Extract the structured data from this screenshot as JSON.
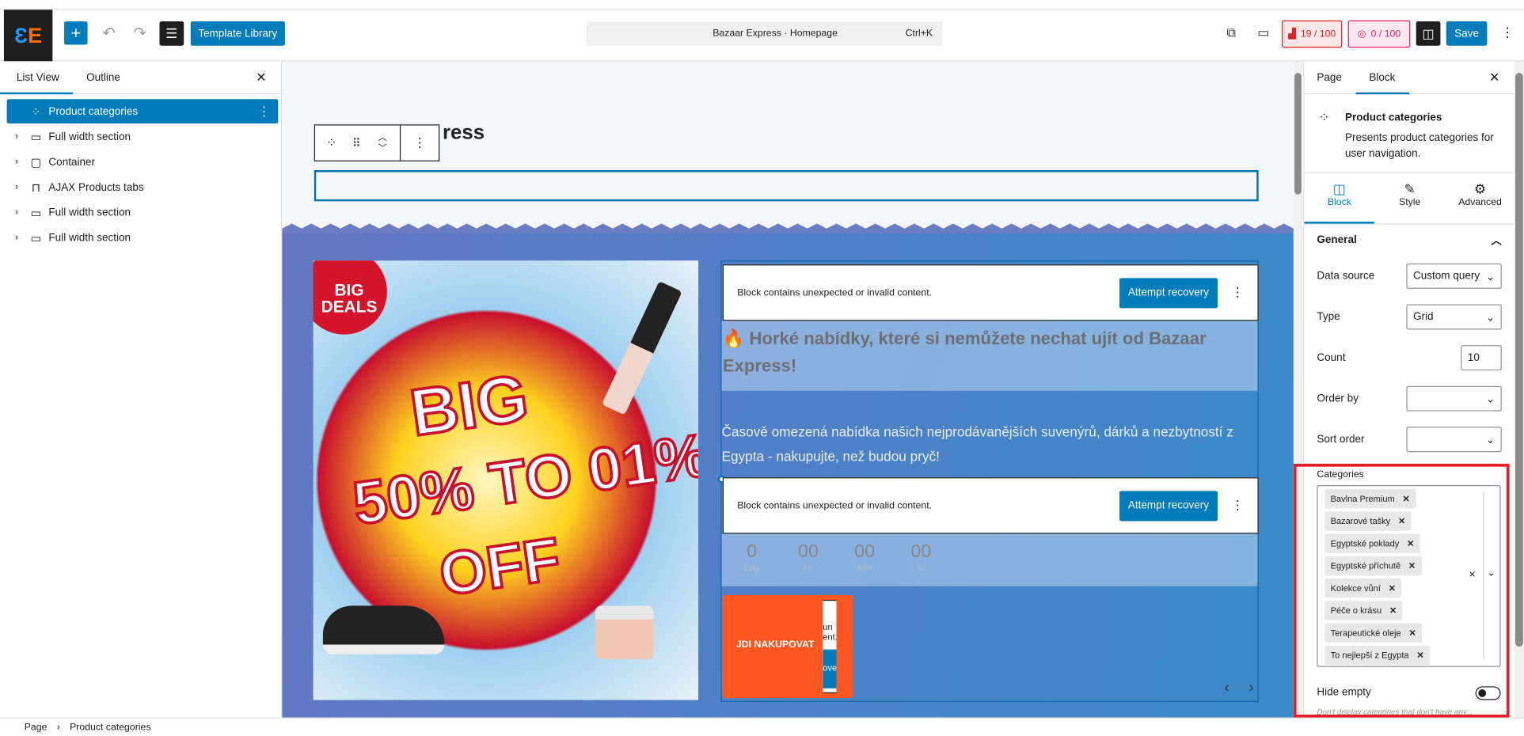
{
  "header": {
    "add_label": "+",
    "template_library": "Template Library",
    "command_bar": {
      "title": "Bazaar Express · Homepage",
      "shortcut": "Ctrl+K"
    },
    "seo_score": "19 / 100",
    "readability_score": "0 / 100",
    "save": "Save"
  },
  "left_panel": {
    "tabs": [
      "List View",
      "Outline"
    ],
    "items": [
      {
        "label": "Product categories",
        "selected": true
      },
      {
        "label": "Full width section"
      },
      {
        "label": "Container"
      },
      {
        "label": "AJAX Products tabs"
      },
      {
        "label": "Full width section"
      },
      {
        "label": "Full width section"
      }
    ]
  },
  "canvas": {
    "heading_partial": "ress",
    "promo_image": {
      "badge": "BIG DEALS",
      "line1": "BIG",
      "line2": "50% TO 01%",
      "line3": "OFF"
    },
    "invalid_message": "Block contains unexpected or invalid content.",
    "attempt_recovery": "Attempt recovery",
    "hot_heading": "🔥 Horké nabídky, které si nemůžete nechat ujít od Bazaar Express!",
    "paragraph": "Časově omezená nabídka našich nejprodávanějších suvenýrů, dárků a nezbytností z Egypta - nakupujte, než budou pryč!",
    "countdown": [
      {
        "value": "0",
        "unit": "Day"
      },
      {
        "value": "00",
        "unit": "Hr"
      },
      {
        "value": "00",
        "unit": "Min"
      },
      {
        "value": "00",
        "unit": "Sc"
      }
    ],
    "shop_button": "JDI NAKUPOVAT",
    "clipped_text": [
      "un",
      "ent.",
      "ove"
    ]
  },
  "sidebar": {
    "tabs": [
      "Page",
      "Block"
    ],
    "block_title": "Product categories",
    "block_desc": "Presents product categories for user navigation.",
    "subtabs": [
      "Block",
      "Style",
      "Advanced"
    ],
    "section": "General",
    "fields": {
      "data_source": {
        "label": "Data source",
        "value": "Custom query"
      },
      "type": {
        "label": "Type",
        "value": "Grid"
      },
      "count": {
        "label": "Count",
        "value": "10"
      },
      "order_by": {
        "label": "Order by",
        "value": ""
      },
      "sort_order": {
        "label": "Sort order",
        "value": ""
      }
    },
    "categories_label": "Categories",
    "categories": [
      "Bavlna Premium",
      "Bazarové tašky",
      "Egyptské poklady",
      "Egyptské příchutě",
      "Kolekce vůní",
      "Péče o krásu",
      "Terapeutické oleje",
      "To nejlepší z Egypta"
    ],
    "hide_empty": {
      "label": "Hide empty",
      "value": false,
      "help": "Don't display categories that don't have any..."
    }
  },
  "breadcrumb": [
    "Page",
    "Product categories"
  ],
  "colors": {
    "accent": "#007cba",
    "highlight": "#e31e24",
    "orange": "#ff5722"
  }
}
